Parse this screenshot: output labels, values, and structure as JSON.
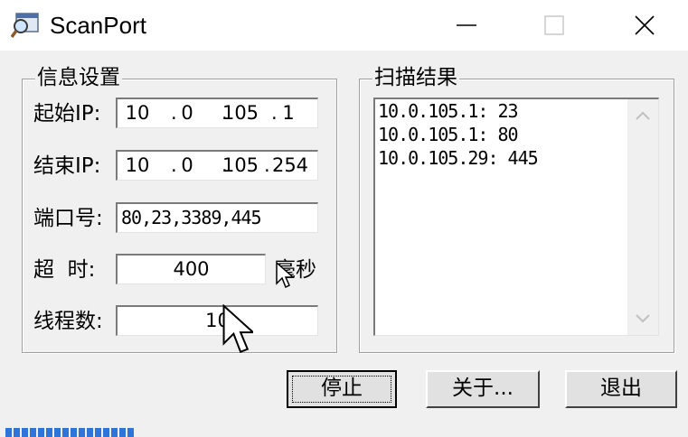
{
  "window": {
    "title": "ScanPort",
    "icons": {
      "app": "magnifier-window-icon",
      "minimize": "minimize-icon",
      "maximize": "maximize-icon",
      "close": "close-icon"
    }
  },
  "info_group": {
    "title": "信息设置",
    "start_ip": {
      "label": "起始IP:",
      "octets": [
        "10",
        "0",
        "105",
        "1"
      ]
    },
    "end_ip": {
      "label": "结束IP:",
      "octets": [
        "10",
        "0",
        "105",
        "254"
      ]
    },
    "ports": {
      "label": "端口号:",
      "value": "80,23,3389,445"
    },
    "timeout": {
      "label": "超  时:",
      "value": "400",
      "unit": "毫秒"
    },
    "threads": {
      "label": "线程数:",
      "value": "10"
    }
  },
  "results_group": {
    "title": "扫描结果",
    "lines": [
      "10.0.105.1: 23",
      "10.0.105.1: 80",
      "10.0.105.29: 445"
    ]
  },
  "buttons": {
    "stop": "停止",
    "about": "关于...",
    "exit": "退出"
  },
  "colors": {
    "progress": "#2f74d9",
    "window_bg": "#f0f0f0"
  }
}
